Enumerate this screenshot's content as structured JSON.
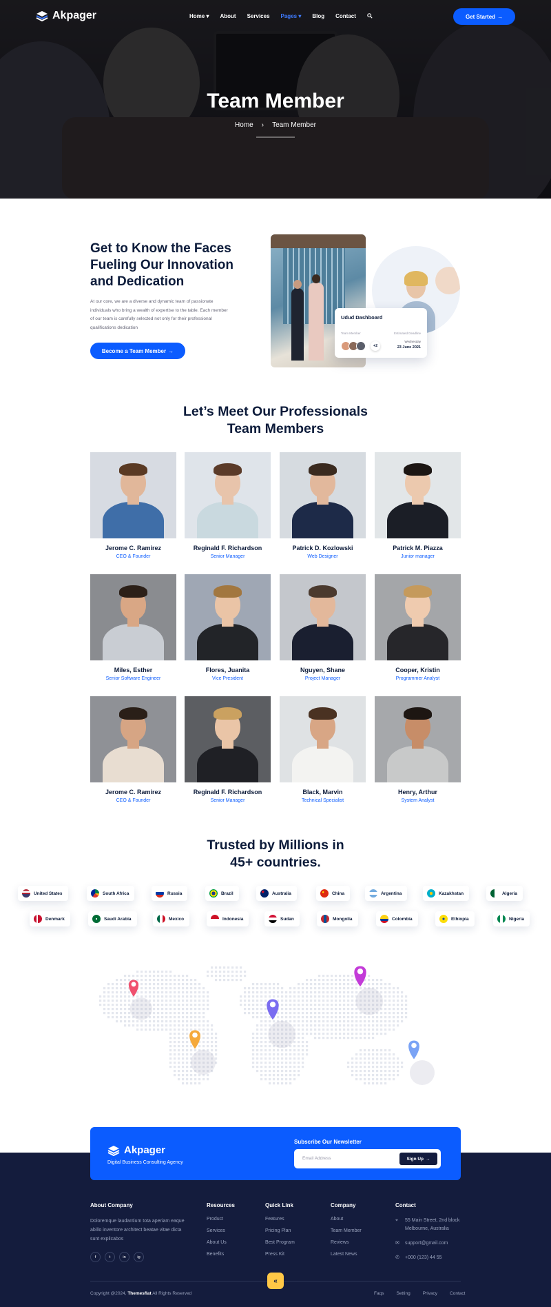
{
  "brand": {
    "name": "Akpager",
    "accent": "#0b5cff",
    "dark": "#141c3d"
  },
  "nav": {
    "items": [
      "Home",
      "About",
      "Services",
      "Pages",
      "Blog",
      "Contact"
    ],
    "active": "Pages",
    "cta": "Get Started"
  },
  "hero": {
    "title": "Team Member",
    "breadcrumb": [
      "Home",
      "Team Member"
    ]
  },
  "about": {
    "heading": "Get to Know the Faces Fueling Our Innovation and Dedication",
    "text": "At our core, we are a diverse and dynamic team of passionate individuals who bring a wealth of expertise to the table. Each member of our team is carefully selected not only for their professional qualifications dedication",
    "button": "Become a Team Member",
    "dashboard": {
      "title": "Udud Dashboard",
      "team_label": "Team Member",
      "deadline_label": "Estimated Deadline",
      "day": "Wednesday",
      "date": "23 June 2021",
      "more": "+2"
    }
  },
  "team": {
    "heading": "Let’s Meet Our Professionals Team Members",
    "members": [
      {
        "name": "Jerome C. Ramirez",
        "role": "CEO & Founder"
      },
      {
        "name": "Reginald F. Richardson",
        "role": "Senior Manager"
      },
      {
        "name": "Patrick D. Kozlowski",
        "role": "Web Designer"
      },
      {
        "name": "Patrick M. Piazza",
        "role": "Junior manager"
      },
      {
        "name": "Miles, Esther",
        "role": "Senior Software Engineer"
      },
      {
        "name": "Flores, Juanita",
        "role": "Vice President"
      },
      {
        "name": "Nguyen, Shane",
        "role": "Project Manager"
      },
      {
        "name": "Cooper, Kristin",
        "role": "Programmer Analyst"
      },
      {
        "name": "Jerome C. Ramirez",
        "role": "CEO & Founder"
      },
      {
        "name": "Reginald F. Richardson",
        "role": "Senior Manager"
      },
      {
        "name": "Black, Marvin",
        "role": "Technical Specialist"
      },
      {
        "name": "Henry, Arthur",
        "role": "System Analyst"
      }
    ]
  },
  "trusted": {
    "heading": "Trusted by Millions in 45+ countries.",
    "countries_row1": [
      "United States",
      "South Africa",
      "Russia",
      "Brazil",
      "Australia",
      "China",
      "Argentina",
      "Kazakhstan",
      "Algeria"
    ],
    "countries_row2": [
      "Denmark",
      "Saudi Arabia",
      "Mexico",
      "Indonesia",
      "Sudan",
      "Mongolia",
      "Colombia",
      "Ethiopia",
      "Nigeria"
    ],
    "pin_colors": [
      "#f0506e",
      "#c33bd8",
      "#7a6cf0",
      "#f5a93b",
      "#7aa3f5"
    ]
  },
  "newsletter": {
    "tagline": "Digital Business Consulting Agency",
    "title": "Subscribe Our Newsletter",
    "placeholder": "Email Address",
    "button": "Sign Up"
  },
  "footer": {
    "about_title": "About Company",
    "about_text": "Doloremque laudantium tota aperiam eaque abillo inventore architect beatae vitae dicta sunt explicabos",
    "social": [
      "f",
      "t",
      "in",
      "ig"
    ],
    "resources_title": "Resources",
    "resources": [
      "Product",
      "Services",
      "About Us",
      "Benefits"
    ],
    "quick_title": "Quick Link",
    "quick": [
      "Features",
      "Pricing Plan",
      "Best Program",
      "Press Kit"
    ],
    "company_title": "Company",
    "company": [
      "About",
      "Team Member",
      "Reviews",
      "Latest News"
    ],
    "contact_title": "Contact",
    "address": "55 Main Street, 2nd block Melbourne, Australia",
    "email": "support@gmail.com",
    "phone": "+000 (123) 44 55",
    "copyright_pre": "Copyright @2024,",
    "copyright_brand": "Themesflat",
    "copyright_post": "All Rights Reserved",
    "links": [
      "Faqs",
      "Setting",
      "Privacy",
      "Contact"
    ]
  }
}
